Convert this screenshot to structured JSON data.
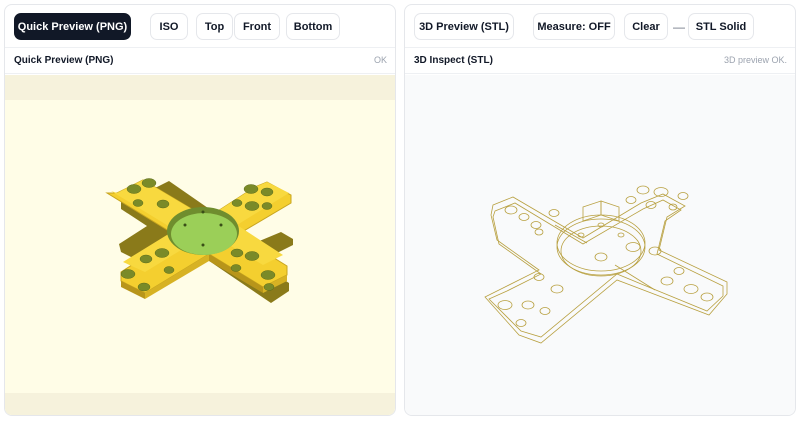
{
  "left": {
    "toolbar": {
      "quick_preview_label": "Quick Preview (PNG)",
      "iso_label": "ISO",
      "top_label": "Top",
      "front_label": "Front",
      "bottom_label": "Bottom"
    },
    "title": "Quick Preview (PNG)",
    "status": "OK"
  },
  "right": {
    "toolbar": {
      "preview_3d_label": "3D Preview (STL)",
      "measure_label": "Measure: OFF",
      "clear_label": "Clear",
      "separator": "—",
      "stl_solid_label": "STL Solid"
    },
    "title": "3D Inspect (STL)",
    "status": "3D preview OK."
  },
  "colors": {
    "primary_button": "#111827",
    "part_yellow": "#f8d73a",
    "part_shadow": "#c9a521",
    "center_green": "#9dcf5a",
    "wire_gold": "#b8a040",
    "left_viewport_bg": "#fffde7"
  }
}
